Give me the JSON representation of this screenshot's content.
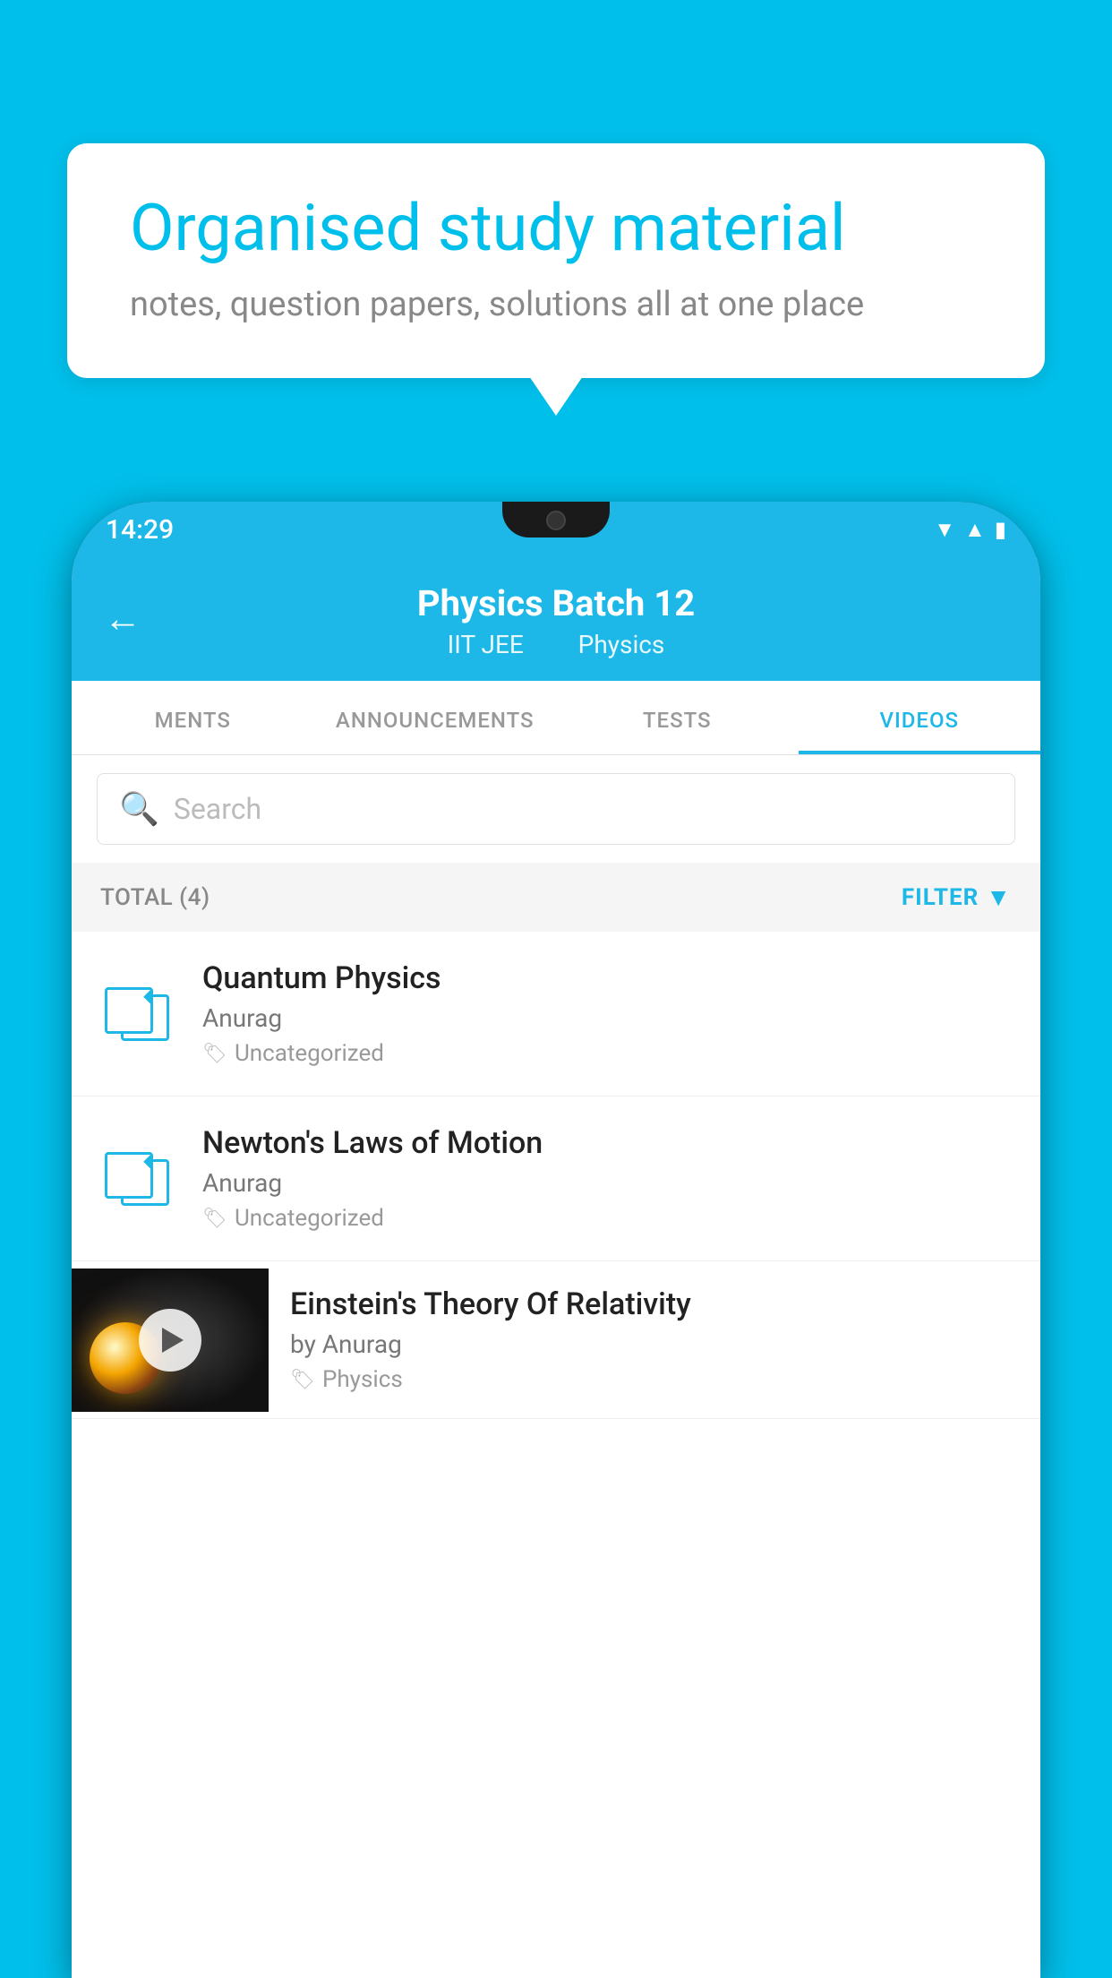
{
  "background_color": "#00BFEA",
  "speech_bubble": {
    "title": "Organised study material",
    "subtitle": "notes, question papers, solutions all at one place"
  },
  "phone": {
    "status_bar": {
      "time": "14:29",
      "icons": [
        "wifi",
        "signal",
        "battery"
      ]
    },
    "header": {
      "back_label": "←",
      "title": "Physics Batch 12",
      "subtitle_left": "IIT JEE",
      "subtitle_right": "Physics"
    },
    "tabs": [
      {
        "label": "MENTS",
        "active": false
      },
      {
        "label": "ANNOUNCEMENTS",
        "active": false
      },
      {
        "label": "TESTS",
        "active": false
      },
      {
        "label": "VIDEOS",
        "active": true
      }
    ],
    "search": {
      "placeholder": "Search"
    },
    "filter_bar": {
      "total_label": "TOTAL (4)",
      "filter_label": "FILTER"
    },
    "videos": [
      {
        "id": 1,
        "title": "Quantum Physics",
        "author": "Anurag",
        "tag": "Uncategorized",
        "has_thumbnail": false
      },
      {
        "id": 2,
        "title": "Newton's Laws of Motion",
        "author": "Anurag",
        "tag": "Uncategorized",
        "has_thumbnail": false
      },
      {
        "id": 3,
        "title": "Einstein's Theory Of Relativity",
        "author": "by Anurag",
        "tag": "Physics",
        "has_thumbnail": true
      }
    ]
  }
}
